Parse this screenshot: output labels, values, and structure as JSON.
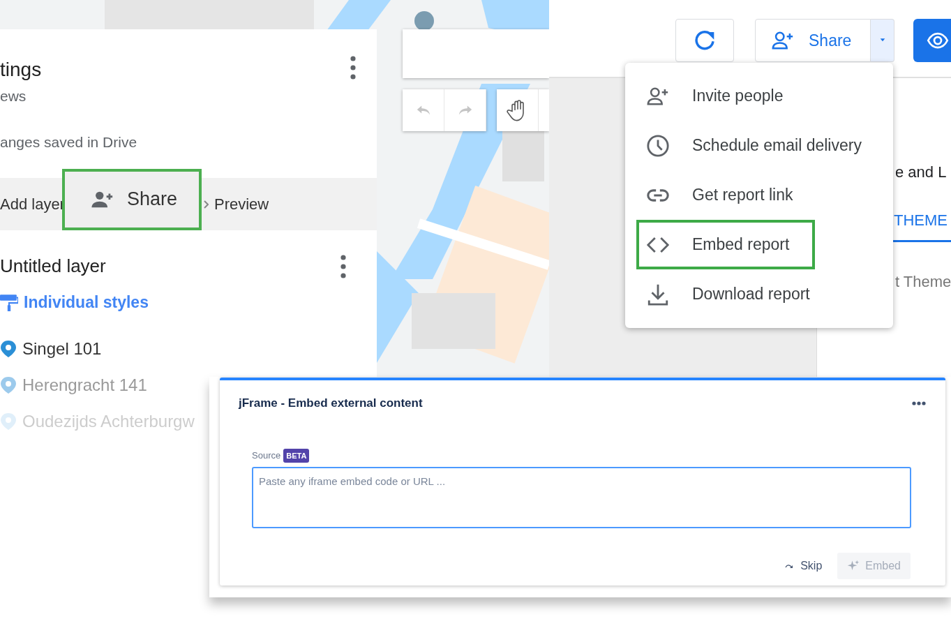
{
  "map_panel": {
    "title": "tings",
    "subtitle": "ews",
    "save_status": "anges saved in Drive",
    "toolbar": [
      {
        "label": "Add layer",
        "kind": "add",
        "highlighted": false
      },
      {
        "label": "Share",
        "kind": "share",
        "highlighted": true
      },
      {
        "label": "Preview",
        "kind": "preview",
        "highlighted": false
      }
    ],
    "layer": {
      "name": "Untitled layer",
      "style": "Individual styles",
      "places": [
        {
          "name": "Singel 101",
          "color": "#2b8fd6"
        },
        {
          "name": "Herengracht 141",
          "color": "#9ccaec"
        },
        {
          "name": "Oudezijds Achterburgw",
          "color": "#e0effa"
        }
      ]
    }
  },
  "report": {
    "share_label": "Share",
    "menu": [
      {
        "label": "Invite people",
        "kind": "invite",
        "highlighted": false
      },
      {
        "label": "Schedule email delivery",
        "kind": "schedule",
        "highlighted": false
      },
      {
        "label": "Get report link",
        "kind": "link",
        "highlighted": false
      },
      {
        "label": "Embed report",
        "kind": "embed",
        "highlighted": true
      },
      {
        "label": "Download report",
        "kind": "download",
        "highlighted": false
      }
    ],
    "side_panel": {
      "heading": "e and L",
      "tab": "THEME",
      "item": "t Theme"
    }
  },
  "dialog": {
    "title": "jFrame - Embed external content",
    "field_label": "Source",
    "badge": "BETA",
    "placeholder": "Paste any iframe embed code or URL ...",
    "buttons": [
      {
        "label": "Skip",
        "kind": "skip",
        "disabled": false
      },
      {
        "label": "Embed",
        "kind": "embed",
        "disabled": true
      }
    ]
  }
}
